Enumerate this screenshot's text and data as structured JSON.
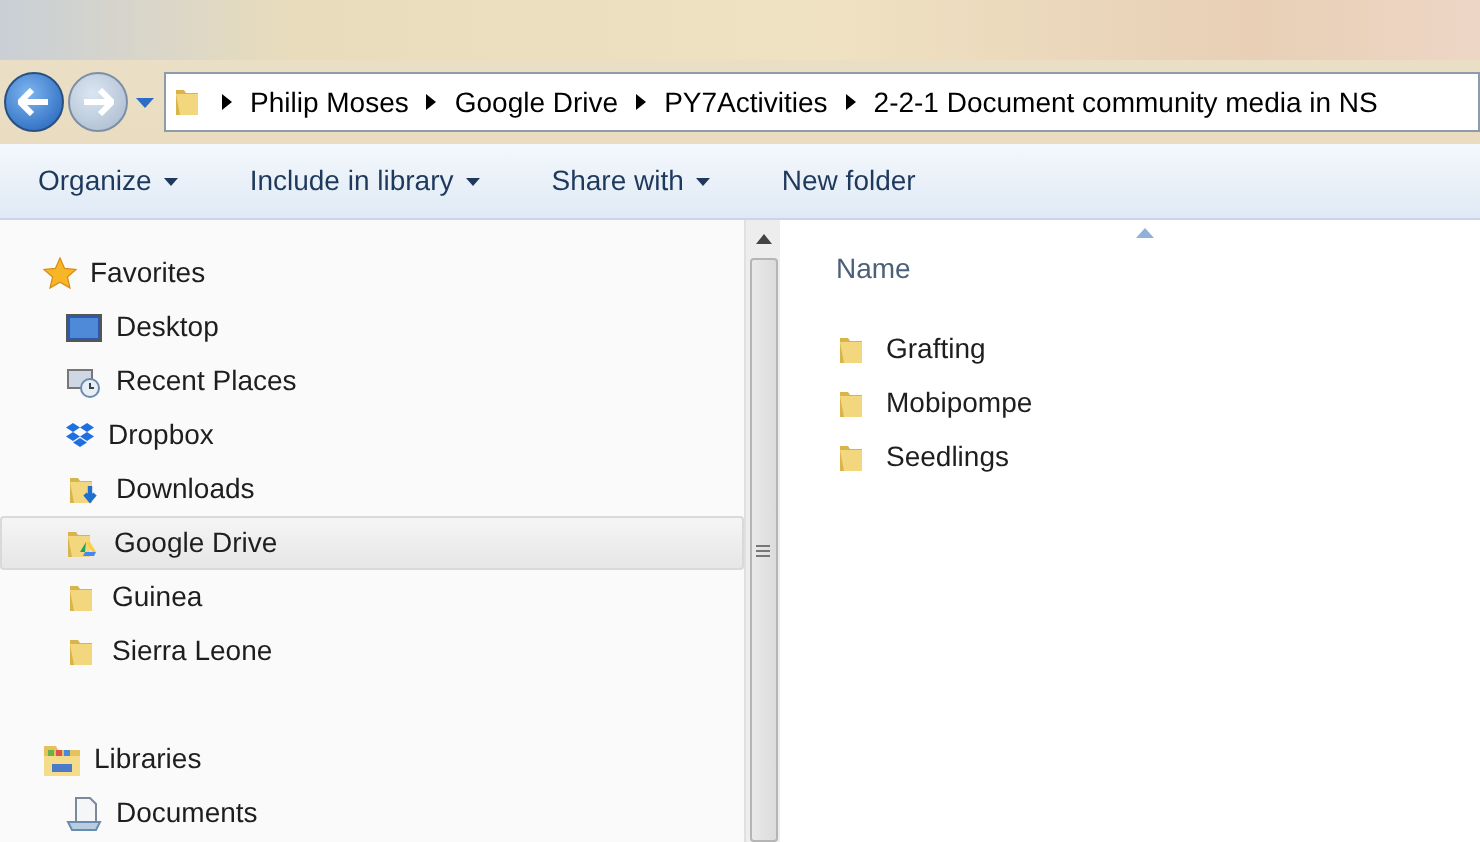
{
  "address_bar": {
    "segments": [
      "Philip Moses",
      "Google Drive",
      "PY7Activities",
      "2-2-1 Document community media in NS"
    ]
  },
  "toolbar": {
    "buttons": [
      {
        "label": "Organize",
        "dropdown": true
      },
      {
        "label": "Include in library",
        "dropdown": true
      },
      {
        "label": "Share with",
        "dropdown": true
      },
      {
        "label": "New folder",
        "dropdown": false
      }
    ]
  },
  "navigation": {
    "groups": [
      {
        "label": "Favorites",
        "children": [
          {
            "label": "Desktop",
            "selected": false
          },
          {
            "label": "Recent Places",
            "selected": false
          },
          {
            "label": "Dropbox",
            "selected": false
          },
          {
            "label": "Downloads",
            "selected": false
          },
          {
            "label": "Google Drive",
            "selected": true
          },
          {
            "label": "Guinea",
            "selected": false
          },
          {
            "label": "Sierra Leone",
            "selected": false
          }
        ]
      },
      {
        "label": "Libraries",
        "children": [
          {
            "label": "Documents",
            "selected": false
          }
        ]
      }
    ]
  },
  "file_list": {
    "columns": [
      {
        "label": "Name",
        "sorted": true
      }
    ],
    "rows": [
      "Grafting",
      "Mobipompe",
      "Seedlings"
    ]
  }
}
